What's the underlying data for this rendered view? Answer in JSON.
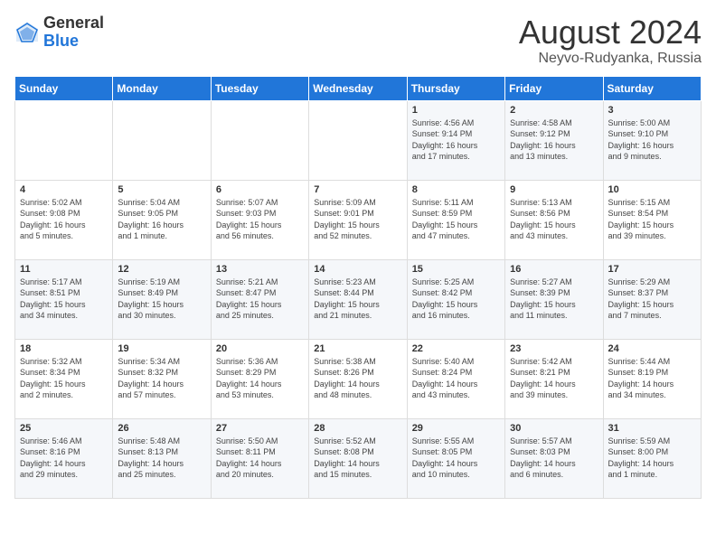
{
  "header": {
    "logo_general": "General",
    "logo_blue": "Blue",
    "month_year": "August 2024",
    "location": "Neyvo-Rudyanka, Russia"
  },
  "days_of_week": [
    "Sunday",
    "Monday",
    "Tuesday",
    "Wednesday",
    "Thursday",
    "Friday",
    "Saturday"
  ],
  "weeks": [
    [
      {
        "day": "",
        "content": ""
      },
      {
        "day": "",
        "content": ""
      },
      {
        "day": "",
        "content": ""
      },
      {
        "day": "",
        "content": ""
      },
      {
        "day": "1",
        "content": "Sunrise: 4:56 AM\nSunset: 9:14 PM\nDaylight: 16 hours\nand 17 minutes."
      },
      {
        "day": "2",
        "content": "Sunrise: 4:58 AM\nSunset: 9:12 PM\nDaylight: 16 hours\nand 13 minutes."
      },
      {
        "day": "3",
        "content": "Sunrise: 5:00 AM\nSunset: 9:10 PM\nDaylight: 16 hours\nand 9 minutes."
      }
    ],
    [
      {
        "day": "4",
        "content": "Sunrise: 5:02 AM\nSunset: 9:08 PM\nDaylight: 16 hours\nand 5 minutes."
      },
      {
        "day": "5",
        "content": "Sunrise: 5:04 AM\nSunset: 9:05 PM\nDaylight: 16 hours\nand 1 minute."
      },
      {
        "day": "6",
        "content": "Sunrise: 5:07 AM\nSunset: 9:03 PM\nDaylight: 15 hours\nand 56 minutes."
      },
      {
        "day": "7",
        "content": "Sunrise: 5:09 AM\nSunset: 9:01 PM\nDaylight: 15 hours\nand 52 minutes."
      },
      {
        "day": "8",
        "content": "Sunrise: 5:11 AM\nSunset: 8:59 PM\nDaylight: 15 hours\nand 47 minutes."
      },
      {
        "day": "9",
        "content": "Sunrise: 5:13 AM\nSunset: 8:56 PM\nDaylight: 15 hours\nand 43 minutes."
      },
      {
        "day": "10",
        "content": "Sunrise: 5:15 AM\nSunset: 8:54 PM\nDaylight: 15 hours\nand 39 minutes."
      }
    ],
    [
      {
        "day": "11",
        "content": "Sunrise: 5:17 AM\nSunset: 8:51 PM\nDaylight: 15 hours\nand 34 minutes."
      },
      {
        "day": "12",
        "content": "Sunrise: 5:19 AM\nSunset: 8:49 PM\nDaylight: 15 hours\nand 30 minutes."
      },
      {
        "day": "13",
        "content": "Sunrise: 5:21 AM\nSunset: 8:47 PM\nDaylight: 15 hours\nand 25 minutes."
      },
      {
        "day": "14",
        "content": "Sunrise: 5:23 AM\nSunset: 8:44 PM\nDaylight: 15 hours\nand 21 minutes."
      },
      {
        "day": "15",
        "content": "Sunrise: 5:25 AM\nSunset: 8:42 PM\nDaylight: 15 hours\nand 16 minutes."
      },
      {
        "day": "16",
        "content": "Sunrise: 5:27 AM\nSunset: 8:39 PM\nDaylight: 15 hours\nand 11 minutes."
      },
      {
        "day": "17",
        "content": "Sunrise: 5:29 AM\nSunset: 8:37 PM\nDaylight: 15 hours\nand 7 minutes."
      }
    ],
    [
      {
        "day": "18",
        "content": "Sunrise: 5:32 AM\nSunset: 8:34 PM\nDaylight: 15 hours\nand 2 minutes."
      },
      {
        "day": "19",
        "content": "Sunrise: 5:34 AM\nSunset: 8:32 PM\nDaylight: 14 hours\nand 57 minutes."
      },
      {
        "day": "20",
        "content": "Sunrise: 5:36 AM\nSunset: 8:29 PM\nDaylight: 14 hours\nand 53 minutes."
      },
      {
        "day": "21",
        "content": "Sunrise: 5:38 AM\nSunset: 8:26 PM\nDaylight: 14 hours\nand 48 minutes."
      },
      {
        "day": "22",
        "content": "Sunrise: 5:40 AM\nSunset: 8:24 PM\nDaylight: 14 hours\nand 43 minutes."
      },
      {
        "day": "23",
        "content": "Sunrise: 5:42 AM\nSunset: 8:21 PM\nDaylight: 14 hours\nand 39 minutes."
      },
      {
        "day": "24",
        "content": "Sunrise: 5:44 AM\nSunset: 8:19 PM\nDaylight: 14 hours\nand 34 minutes."
      }
    ],
    [
      {
        "day": "25",
        "content": "Sunrise: 5:46 AM\nSunset: 8:16 PM\nDaylight: 14 hours\nand 29 minutes."
      },
      {
        "day": "26",
        "content": "Sunrise: 5:48 AM\nSunset: 8:13 PM\nDaylight: 14 hours\nand 25 minutes."
      },
      {
        "day": "27",
        "content": "Sunrise: 5:50 AM\nSunset: 8:11 PM\nDaylight: 14 hours\nand 20 minutes."
      },
      {
        "day": "28",
        "content": "Sunrise: 5:52 AM\nSunset: 8:08 PM\nDaylight: 14 hours\nand 15 minutes."
      },
      {
        "day": "29",
        "content": "Sunrise: 5:55 AM\nSunset: 8:05 PM\nDaylight: 14 hours\nand 10 minutes."
      },
      {
        "day": "30",
        "content": "Sunrise: 5:57 AM\nSunset: 8:03 PM\nDaylight: 14 hours\nand 6 minutes."
      },
      {
        "day": "31",
        "content": "Sunrise: 5:59 AM\nSunset: 8:00 PM\nDaylight: 14 hours\nand 1 minute."
      }
    ]
  ]
}
